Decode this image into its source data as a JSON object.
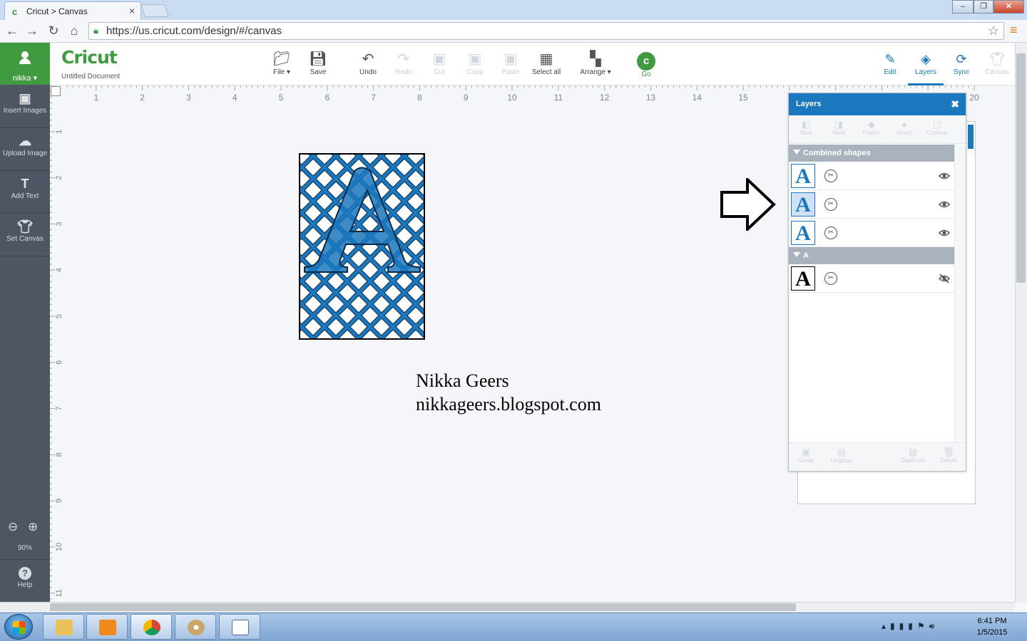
{
  "browser": {
    "tab_title": "Cricut > Canvas",
    "tab_favicon": "c",
    "url": "https://us.cricut.com/design/#/canvas"
  },
  "app": {
    "logo_text": "Cricut",
    "document_name": "Untitled Document",
    "user_name": "nikka ▾",
    "brand_green": "#3f9a40",
    "accent_blue": "#1b78be"
  },
  "sidebar": {
    "items": [
      {
        "icon": "insert-images-icon",
        "label": "Insert Images"
      },
      {
        "icon": "upload-image-icon",
        "label": "Upload Image"
      },
      {
        "icon": "add-text-icon",
        "label": "Add Text"
      },
      {
        "icon": "set-canvas-icon",
        "label": "Set Canvas"
      }
    ],
    "zoom_level": "90%",
    "help_label": "Help"
  },
  "toolbar": {
    "file": "File ▾",
    "save": "Save",
    "undo": "Undo",
    "redo": "Redo",
    "cut": "Cut",
    "copy": "Copy",
    "paste": "Paste",
    "select_all": "Select all",
    "arrange": "Arrange ▾",
    "go": "Go"
  },
  "right_tabs": {
    "edit": "Edit",
    "layers": "Layers",
    "sync": "Sync",
    "canvas": "Canvas"
  },
  "ruler": {
    "h_labels": [
      "1",
      "2",
      "3",
      "4",
      "5",
      "6",
      "7",
      "8",
      "9",
      "10",
      "11",
      "12",
      "13",
      "14",
      "15",
      "20"
    ],
    "v_labels": [
      "1",
      "2",
      "3",
      "4",
      "5",
      "6",
      "7",
      "8",
      "9",
      "10",
      "11"
    ]
  },
  "canvas": {
    "caption_line1": "Nikka Geers",
    "caption_line2": "nikkageers.blogspot.com",
    "design_letter": "A"
  },
  "layers_panel": {
    "title": "Layers",
    "top_tools": [
      "Slice",
      "Weld",
      "Flatten",
      "Attach",
      "Contour"
    ],
    "groups": [
      {
        "name": "Combined shapes",
        "rows": [
          {
            "thumb": "A",
            "visible": true
          },
          {
            "thumb": "A",
            "visible": true
          },
          {
            "thumb": "A",
            "visible": true
          }
        ]
      },
      {
        "name": "A",
        "rows": [
          {
            "thumb": "A",
            "visible": false
          }
        ]
      }
    ],
    "bottom_tools": [
      "Group",
      "Ungroup",
      "Duplicate",
      "Delete"
    ]
  },
  "taskbar": {
    "time": "6:41 PM",
    "date": "1/5/2015"
  }
}
